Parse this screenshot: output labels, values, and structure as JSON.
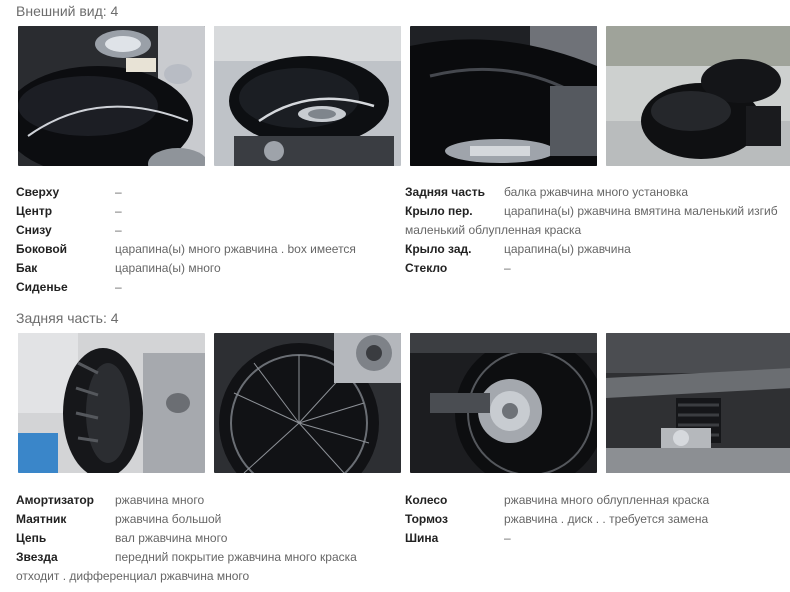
{
  "sections": [
    {
      "title": "Внешний вид: 4",
      "photos": [
        {
          "icon": "tank-gauge-photo"
        },
        {
          "icon": "fuel-tank-photo"
        },
        {
          "icon": "engine-cover-photo"
        },
        {
          "icon": "seat-photo"
        }
      ],
      "left": [
        {
          "label": "Сверху",
          "value": "–"
        },
        {
          "label": "Центр",
          "value": "–"
        },
        {
          "label": "Снизу",
          "value": "–"
        },
        {
          "label": "Боковой",
          "value": "царапина(ы) много ржавчина . box имеется"
        },
        {
          "label": "Бак",
          "value": "царапина(ы) много"
        },
        {
          "label": "Сиденье",
          "value": "–"
        }
      ],
      "right": [
        {
          "label": "Задняя часть",
          "value": "балка ржавчина много установка"
        },
        {
          "label": "Крыло пер.",
          "value": "царапина(ы) ржавчина вмятина маленький изгиб",
          "cont": "маленький облупленная краска"
        },
        {
          "label": "Крыло зад.",
          "value": "царапина(ы) ржавчина"
        },
        {
          "label": "Стекло",
          "value": "–"
        }
      ]
    },
    {
      "title": "Задняя часть: 4",
      "photos": [
        {
          "icon": "rear-tire-photo"
        },
        {
          "icon": "spoke-wheel-photo"
        },
        {
          "icon": "drive-hub-photo"
        },
        {
          "icon": "shock-absorber-photo"
        }
      ],
      "left": [
        {
          "label": "Амортизатор",
          "value": "ржавчина много"
        },
        {
          "label": "Маятник",
          "value": "ржавчина большой"
        },
        {
          "label": "Цепь",
          "value": "вал ржавчина много"
        },
        {
          "label": "Звезда",
          "value": "передний покрытие ржавчина много краска",
          "cont": "отходит . дифференциал ржавчина много"
        }
      ],
      "right": [
        {
          "label": "Колесо",
          "value": "ржавчина много облупленная краска"
        },
        {
          "label": "Тормоз",
          "value": "ржавчина . диск . . требуется замена"
        },
        {
          "label": "Шина",
          "value": "–"
        }
      ]
    }
  ]
}
